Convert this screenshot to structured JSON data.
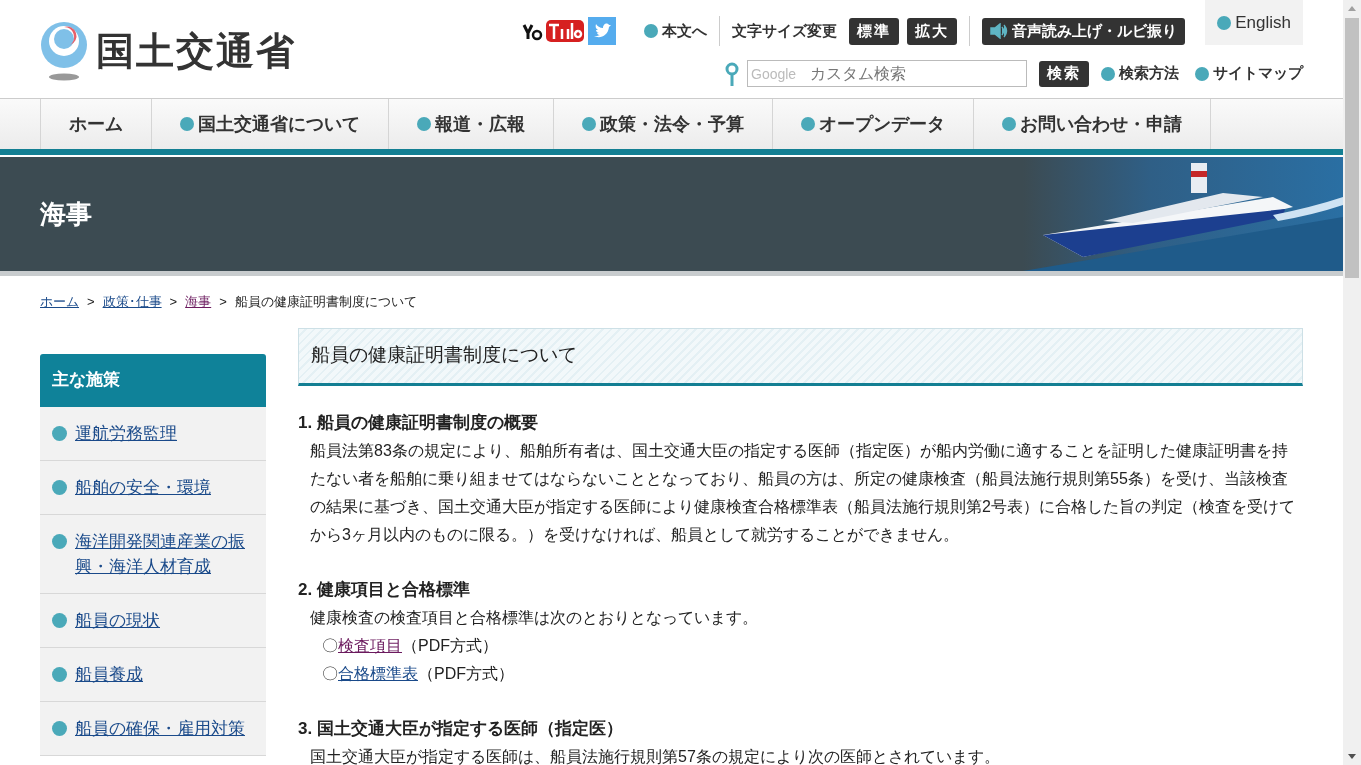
{
  "header": {
    "logo_text": "国土交通省",
    "skip_link": "本文へ",
    "font_size_label": "文字サイズ変更",
    "font_size_buttons": [
      "標準",
      "拡大"
    ],
    "speech_button": "音声読み上げ・ルビ振り",
    "english_link": "English",
    "search": {
      "placeholder": "カスタム検索",
      "brand": "Google"
    },
    "search_button": "検索",
    "search_links": [
      "検索方法",
      "サイトマップ"
    ]
  },
  "nav": [
    "ホーム",
    "国土交通省について",
    "報道・広報",
    "政策・法令・予算",
    "オープンデータ",
    "お問い合わせ・申請"
  ],
  "banner": {
    "title": "海事"
  },
  "breadcrumb": [
    {
      "label": "ホーム",
      "visited": false,
      "separator": ">"
    },
    {
      "label": "政策･仕事",
      "visited": false,
      "separator": ">"
    },
    {
      "label": "海事",
      "visited": true,
      "separator": ">"
    }
  ],
  "breadcrumb_current": "船員の健康証明書制度について",
  "sidebar": {
    "title": "主な施策",
    "items": [
      "運航労務監理",
      "船舶の安全・環境",
      "海洋開発関連産業の振興・海洋人材育成",
      "船員の現状",
      "船員養成",
      "船員の確保・雇用対策"
    ]
  },
  "page_title": "船員の健康証明書制度について",
  "sections": [
    {
      "heading": "1. 船員の健康証明書制度の概要",
      "body": "船員法第83条の規定により、船舶所有者は、国土交通大臣の指定する医師（指定医）が船内労働に適することを証明した健康証明書を持たない者を船舶に乗り組ませてはならないこととなっており、船員の方は、所定の健康検査（船員法施行規則第55条）を受け、当該検査の結果に基づき、国土交通大臣が指定する医師により健康検査合格標準表（船員法施行規則第2号表）に合格した旨の判定（検査を受けてから3ヶ月以内のものに限る。）を受けなければ、船員として就労することができません。"
    },
    {
      "heading": "2. 健康項目と合格標準",
      "body": "健康検査の検査項目と合格標準は次のとおりとなっています。",
      "links": [
        {
          "bullet": "〇",
          "label": "検査項目",
          "suffix": "（PDF方式）",
          "visited": true
        },
        {
          "bullet": "〇",
          "label": "合格標準表",
          "suffix": "（PDF方式）",
          "visited": false
        }
      ]
    },
    {
      "heading": "3. 国土交通大臣が指定する医師（指定医）",
      "body": "国土交通大臣が指定する医師は、船員法施行規則第57条の規定により次の医師とされています。"
    }
  ]
}
